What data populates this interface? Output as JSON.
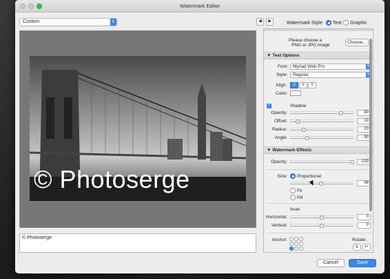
{
  "window": {
    "title": "Watermark Editor"
  },
  "toolbar": {
    "preset_value": "Custom",
    "nav_prev": "◀",
    "nav_next": "▶",
    "style_label": "Watermark Style:",
    "style_options": [
      {
        "label": "Text",
        "selected": true
      },
      {
        "label": "Graphic",
        "selected": false
      }
    ]
  },
  "preview": {
    "watermark_text": "© Photoserge"
  },
  "text_input": {
    "value": "© Photoserge"
  },
  "image_options": {
    "hint_line1": "Please choose a",
    "hint_line2": "PNG or JPG image",
    "choose_label": "Choose..."
  },
  "text_options": {
    "heading": "Text Options",
    "font_label": "Font:",
    "font_value": "Myriad Web Pro",
    "style_label": "Style:",
    "style_value": "Regular",
    "align_label": "Align:",
    "color_label": "Color:"
  },
  "shadow": {
    "heading": "Shadow",
    "enabled": true,
    "rows": [
      {
        "label": "Opacity:",
        "value": "80",
        "fraction": 0.8
      },
      {
        "label": "Offset:",
        "value": "10",
        "fraction": 0.1
      },
      {
        "label": "Radius:",
        "value": "20",
        "fraction": 0.2
      },
      {
        "label": "Angle:",
        "value": "- 90",
        "fraction": 0.25
      }
    ]
  },
  "watermark_effects": {
    "heading": "Watermark Effects",
    "opacity_label": "Opacity:",
    "opacity_value": "100",
    "opacity_fraction": 1.0,
    "size_label": "Size:",
    "size_options": [
      {
        "label": "Proportional",
        "selected": true
      },
      {
        "label": "Fit",
        "selected": false
      },
      {
        "label": "Fill",
        "selected": false
      }
    ],
    "size_value": "48",
    "size_fraction": 0.48,
    "inset_label": "Inset",
    "horizontal_label": "Horizontal:",
    "horizontal_value": "0",
    "vertical_label": "Vertical:",
    "vertical_value": "0",
    "anchor_label": "Anchor:",
    "rotate_label": "Rotate:",
    "rotate_cw": "↳",
    "rotate_ccw": "↵"
  },
  "footer": {
    "cancel_label": "Cancel",
    "save_label": "Save"
  },
  "colors": {
    "accent": "#3a87e8"
  }
}
